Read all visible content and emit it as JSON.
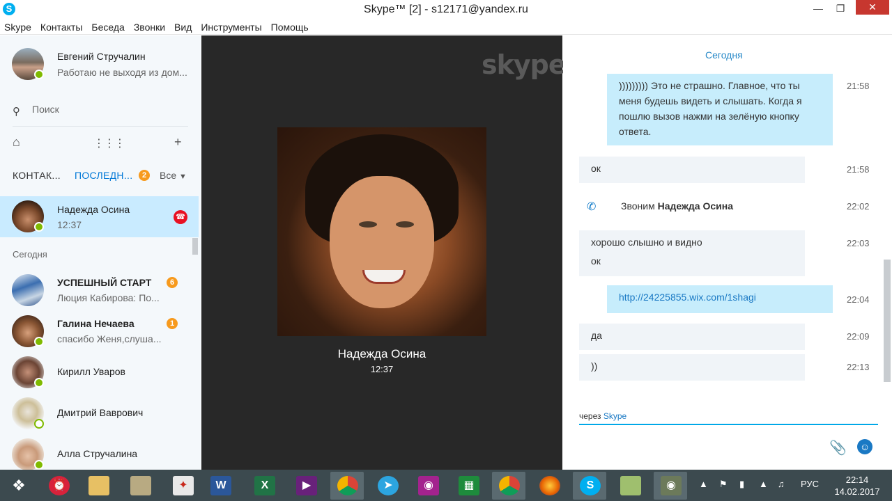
{
  "window": {
    "title": "Skype™ [2] - s12171@yandex.ru",
    "min_icon": "minimize-icon",
    "max_icon": "maximize-icon",
    "close_icon": "close-icon"
  },
  "menu": [
    "Skype",
    "Контакты",
    "Беседа",
    "Звонки",
    "Вид",
    "Инструменты",
    "Помощь"
  ],
  "profile": {
    "name": "Евгений Стручалин",
    "mood": "Работаю не выходя из дом..."
  },
  "search": {
    "label": "Поиск"
  },
  "tabs": {
    "contacts": "КОНТАК...",
    "recent": "ПОСЛЕДН...",
    "recent_badge": "2",
    "all": "Все"
  },
  "active_contact": {
    "name": "Надежда Осина",
    "time": "12:37"
  },
  "section_today": "Сегодня",
  "contacts": [
    {
      "name": "УСПЕШНЫЙ СТАРТ",
      "sub": "Люция Кабирова: По...",
      "badge": "6",
      "bold": true
    },
    {
      "name": "Галина Нечаева",
      "sub": "спасибо Женя,слуша...",
      "badge": "1",
      "bold": true
    },
    {
      "name": "Кирилл Уваров",
      "sub": "",
      "badge": "",
      "bold": false
    },
    {
      "name": "Дмитрий Ваврович",
      "sub": "",
      "badge": "",
      "bold": false
    },
    {
      "name": "Алла Стручалина",
      "sub": "",
      "badge": "",
      "bold": false
    }
  ],
  "call": {
    "logo": "skype",
    "name": "Надежда Осина",
    "time": "12:37"
  },
  "conversation": {
    "date": "Сегодня",
    "messages": [
      {
        "dir": "out",
        "text": "))))))))) Это не страшно. Главное, что ты меня будешь видеть и слышать. Когда я пошлю вызов нажми на зелёную кнопку ответа.",
        "time": "21:58"
      },
      {
        "dir": "in",
        "text": "ок",
        "time": "21:58"
      },
      {
        "dir": "in",
        "text": "хорошо слышно и видно",
        "text2": "ок",
        "time": "22:03"
      },
      {
        "dir": "out",
        "text": "http://24225855.wix.com/1shagi",
        "time": "22:04"
      },
      {
        "dir": "in",
        "text": "да",
        "time": "22:09"
      },
      {
        "dir": "in",
        "text": "))",
        "time": "22:13"
      }
    ],
    "call_note": {
      "prefix": "Звоним",
      "name": "Надежда Осина",
      "time": "22:02"
    },
    "via_prefix": "через",
    "via_service": "Skype"
  },
  "taskbar": {
    "lang": "РУС",
    "time": "22:14",
    "date": "14.02.2017"
  }
}
